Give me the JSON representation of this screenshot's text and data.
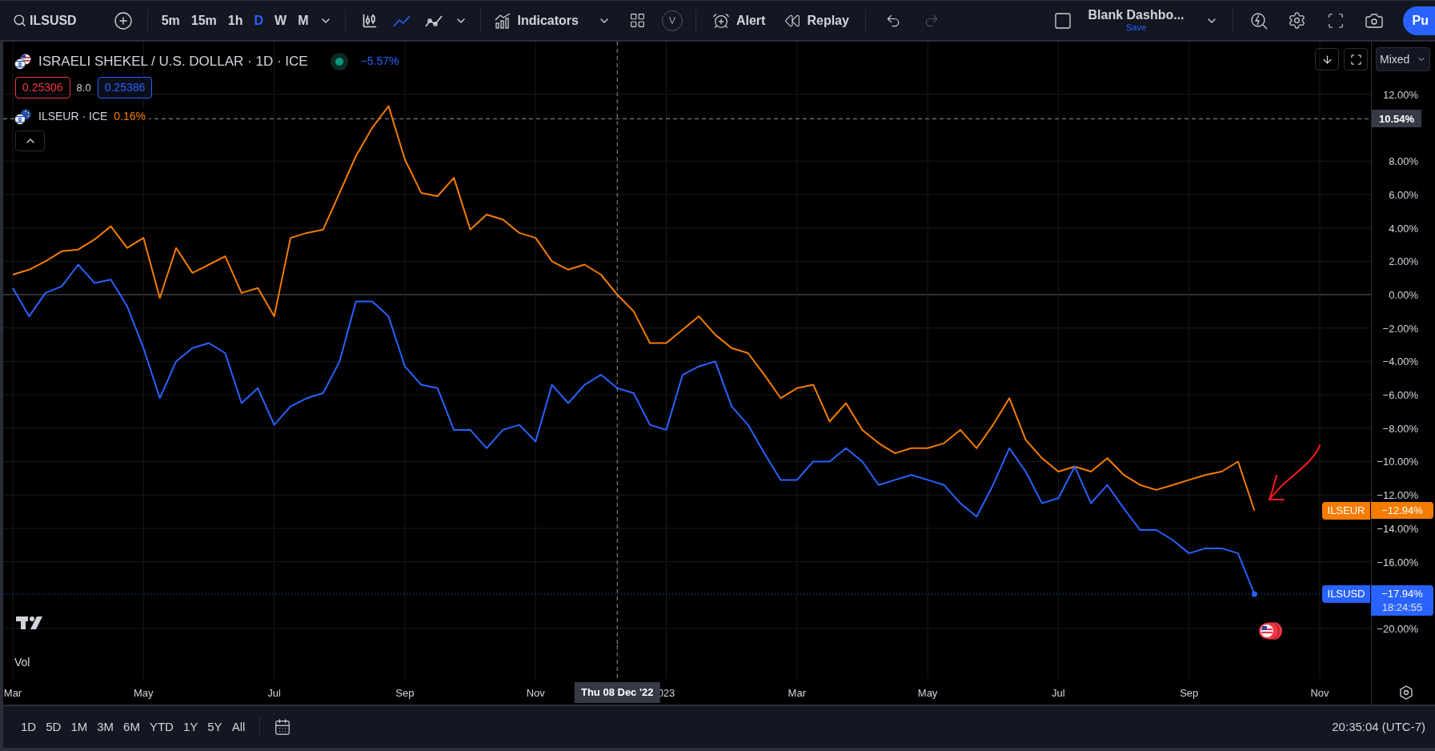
{
  "toolbar": {
    "symbol": "ILSUSD",
    "intervals": [
      {
        "label": "5m",
        "selected": false
      },
      {
        "label": "15m",
        "selected": false
      },
      {
        "label": "1h",
        "selected": false
      },
      {
        "label": "D",
        "selected": true
      },
      {
        "label": "W",
        "selected": false
      },
      {
        "label": "M",
        "selected": false
      }
    ],
    "chart_styles": [
      {
        "kind": "candles",
        "selected": false
      },
      {
        "kind": "line",
        "selected": true
      },
      {
        "kind": "line-markers",
        "selected": false
      }
    ],
    "indicators": "Indicators",
    "template_badge": "V",
    "alert": "Alert",
    "replay": "Replay",
    "undo": {
      "disabled": false
    },
    "redo": {
      "disabled": true
    },
    "layout": {
      "name": "Blank Dashbo...",
      "status": "Save"
    },
    "publish": "Pu"
  },
  "legend": {
    "title": "ISRAELI SHEKEL / U.S. DOLLAR · 1D · ICE",
    "market_open": true,
    "change": "−5.57%",
    "bid": "0.25306",
    "spread": "8.0",
    "ask": "0.25386",
    "compare": {
      "title": "ILSEUR · ICE",
      "change": "0.16%"
    }
  },
  "pane_controls": {
    "scale_mode": "Mixed"
  },
  "chart": {
    "chart_data": {
      "type": "line",
      "ylim": [
        -24.56,
        15.16
      ],
      "grid": true,
      "categories": [
        "Mar",
        null,
        null,
        null,
        null,
        null,
        null,
        null,
        "May",
        null,
        null,
        null,
        null,
        null,
        null,
        null,
        "Jul",
        null,
        null,
        null,
        null,
        null,
        null,
        null,
        "Sep",
        null,
        null,
        null,
        null,
        null,
        null,
        null,
        "Nov",
        null,
        null,
        null,
        null,
        "Thu 08 Dec '22",
        null,
        null,
        "023",
        null,
        null,
        null,
        null,
        null,
        null,
        null,
        "Mar",
        null,
        null,
        null,
        null,
        null,
        null,
        null,
        "May",
        null,
        null,
        null,
        null,
        null,
        null,
        null,
        "Jul",
        null,
        null,
        null,
        null,
        null,
        null,
        null,
        "Sep",
        null,
        null,
        null,
        null,
        null,
        null,
        null,
        "Nov"
      ],
      "series": [
        {
          "name": "ILSEUR",
          "color": "#f57c00",
          "values": [
            1.2,
            1.5,
            2.0,
            2.6,
            2.7,
            3.3,
            4.1,
            2.8,
            3.4,
            -0.2,
            2.8,
            1.3,
            1.8,
            2.3,
            0.1,
            0.4,
            -1.3,
            3.4,
            3.7,
            3.9,
            6.1,
            8.3,
            10.0,
            11.3,
            8.1,
            6.1,
            5.9,
            7.0,
            3.9,
            4.8,
            4.5,
            3.7,
            3.4,
            2.0,
            1.5,
            1.8,
            1.2,
            0.0,
            -1.0,
            -2.9,
            -2.9,
            -2.1,
            -1.3,
            -2.4,
            -3.2,
            -3.5,
            -4.8,
            -6.2,
            -5.6,
            -5.4,
            -7.6,
            -6.5,
            -8.1,
            -8.9,
            -9.5,
            -9.2,
            -9.2,
            -8.9,
            -8.1,
            -9.2,
            -7.8,
            -6.2,
            -8.7,
            -9.8,
            -10.6,
            -10.3,
            -10.6,
            -9.8,
            -10.8,
            -11.4,
            -11.7,
            -11.4,
            -11.1,
            -10.8,
            -10.6,
            -10.0,
            -12.94,
            null,
            null,
            null,
            null
          ]
        },
        {
          "name": "ILSUSD",
          "color": "#2962ff",
          "values": [
            0.4,
            -1.3,
            0.1,
            0.5,
            1.8,
            0.7,
            0.9,
            -0.7,
            -3.2,
            -6.2,
            -4.0,
            -3.2,
            -2.9,
            -3.5,
            -6.5,
            -5.6,
            -7.8,
            -6.7,
            -6.2,
            -5.9,
            -4.0,
            -0.4,
            -0.4,
            -1.3,
            -4.3,
            -5.4,
            -5.6,
            -8.1,
            -8.1,
            -9.2,
            -8.1,
            -7.8,
            -8.8,
            -5.4,
            -6.5,
            -5.4,
            -4.8,
            -5.6,
            -5.9,
            -7.8,
            -8.1,
            -4.8,
            -4.3,
            -4.0,
            -6.7,
            -7.8,
            -9.5,
            -11.1,
            -11.1,
            -10.0,
            -10.0,
            -9.2,
            -10.0,
            -11.4,
            -11.1,
            -10.8,
            -11.1,
            -11.4,
            -12.5,
            -13.3,
            -11.4,
            -9.2,
            -10.6,
            -12.5,
            -12.2,
            -10.3,
            -12.5,
            -11.4,
            -12.8,
            -14.1,
            -14.1,
            -14.7,
            -15.5,
            -15.2,
            -15.2,
            -15.5,
            -17.94,
            null,
            null,
            null,
            null
          ]
        }
      ],
      "yticks": [
        {
          "value": 12,
          "label": "12.00%"
        },
        {
          "value": 8,
          "label": "8.00%"
        },
        {
          "value": 6,
          "label": "6.00%"
        },
        {
          "value": 4,
          "label": "4.00%"
        },
        {
          "value": 2,
          "label": "2.00%"
        },
        {
          "value": 0,
          "label": "0.00%"
        },
        {
          "value": -2,
          "label": "−2.00%"
        },
        {
          "value": -4,
          "label": "−4.00%"
        },
        {
          "value": -6,
          "label": "−6.00%"
        },
        {
          "value": -8,
          "label": "−8.00%"
        },
        {
          "value": -10,
          "label": "−10.00%"
        },
        {
          "value": -12,
          "label": "−12.00%"
        },
        {
          "value": -14,
          "label": "−14.00%"
        },
        {
          "value": -16,
          "label": "−16.00%"
        },
        {
          "value": -20,
          "label": "−20.00%"
        }
      ],
      "ref_lines": [
        {
          "axis": "x",
          "value": "Thu 08 Dec '22",
          "color": "#9598a1"
        },
        {
          "axis": "y",
          "value": 10.54,
          "label": "10.54%",
          "color": "#9598a1"
        },
        {
          "axis": "y",
          "value": -17.94,
          "color": "#2962ff"
        }
      ]
    }
  },
  "price_tags": [
    {
      "value": "−12.94%",
      "color": "#f57c00"
    },
    {
      "value": "−17.94%",
      "countdown": "18:24:55",
      "color": "#2962ff"
    }
  ],
  "volume_pane": {
    "label": "Vol"
  },
  "ranges": [
    {
      "label": "1D"
    },
    {
      "label": "5D"
    },
    {
      "label": "1M"
    },
    {
      "label": "3M"
    },
    {
      "label": "6M"
    },
    {
      "label": "YTD"
    },
    {
      "label": "1Y"
    },
    {
      "label": "5Y"
    },
    {
      "label": "All"
    }
  ],
  "clock": "20:35:04 (UTC-7)"
}
